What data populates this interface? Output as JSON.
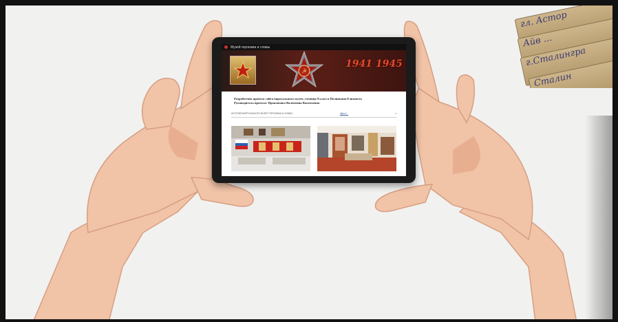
{
  "tablet_screen": {
    "tab_title": "Музей героизма и славы",
    "banner": {
      "years": "1941 1945"
    },
    "developers_text": [
      "Разработчик проекта сайта виртуального музея: ученица 9 класса Поливкина Елизавета",
      "Руководитель проекта: Проконенко Валентина Васильевна"
    ],
    "nav_left": "ИСТОРИЯ ВИРТУАЛЬНОГО МУЗЕЯ \"ГЕРОИЗМА И СЛАВЫ\"",
    "nav_right": "https://..."
  },
  "letters": [
    "гл. Астор",
    "Айв ...",
    "г.Сталингра",
    "Сталин"
  ],
  "colors": {
    "page_bg": "#121212",
    "slide_bg": "#f1f1f0",
    "skin": "#f1c3a7",
    "banner_red": "#e14a2a"
  }
}
